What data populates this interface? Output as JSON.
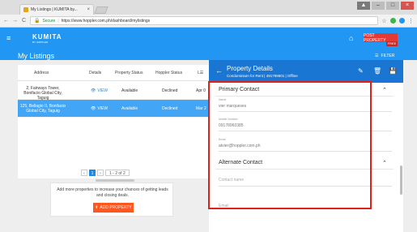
{
  "browser": {
    "tab_title": "My Listings | KUMITA by...",
    "tab_close": "×",
    "secure_label": "Secure",
    "url": "https://www.hoppler.com.ph/dashboard/mylistings",
    "win_user": "▲",
    "win_min": "–",
    "win_max": "□",
    "win_close": "×"
  },
  "header": {
    "logo": "KUMITA",
    "logo_sub": "BY HOPPLER",
    "page_title": "My Listings",
    "post_button": "POST PROPERTY",
    "free_badge": "FREE",
    "filter_label": "FILTER",
    "accent": "#2196f3"
  },
  "table": {
    "columns": [
      "Address",
      "Details",
      "Property Status",
      "Hoppler Status",
      "L☰"
    ],
    "rows": [
      {
        "address": "2, Fairways Tower, Bonifacio Global City, Taguig",
        "details": "VIEW",
        "property_status": "Available",
        "hoppler_status": "Declined",
        "date": "Apr 0",
        "selected": false
      },
      {
        "address": "125, Bellagio II, Bonifacio Global City, Taguig",
        "details": "VIEW",
        "property_status": "Available",
        "hoppler_status": "Declined",
        "date": "Mar 2",
        "selected": true
      }
    ],
    "pager": {
      "prev": "‹",
      "page": "1",
      "next": "›",
      "info": "1 - 2 of 2"
    }
  },
  "cta": {
    "text": "Add more properties to increase your chances of getting leads and closing deals.",
    "button": "ADD PROPERTY"
  },
  "drawer": {
    "title": "Property Details",
    "subtitle": "Condominium for Rent | 491789601 | Offline",
    "primary": {
      "title": "Primary Contact",
      "fields": [
        {
          "label": "Name",
          "value": "vier marqueses"
        },
        {
          "label": "Mobile Number",
          "value": "09178960385"
        },
        {
          "label": "Email",
          "value": "atvier@hoppler.com.ph"
        }
      ]
    },
    "alternate": {
      "title": "Alternate Contact",
      "name_placeholder": "Contact name",
      "email_placeholder": "Email"
    }
  }
}
